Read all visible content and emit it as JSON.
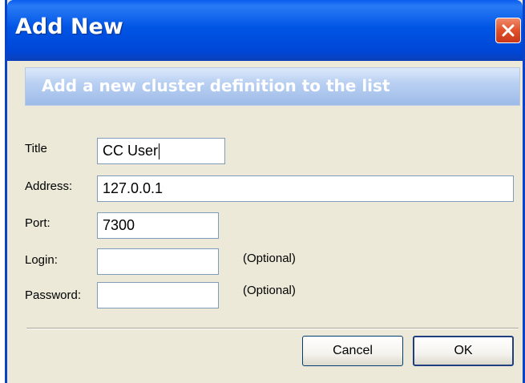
{
  "window": {
    "title": "Add New"
  },
  "banner": {
    "text": "Add a new cluster definition to the list"
  },
  "form": {
    "title_label": "Title",
    "title_value": "CC User",
    "address_label": "Address:",
    "address_value": "127.0.0.1",
    "port_label": "Port:",
    "port_value": "7300",
    "login_label": "Login:",
    "login_value": "",
    "login_hint": "(Optional)",
    "password_label": "Password:",
    "password_value": "",
    "password_hint": "(Optional)"
  },
  "buttons": {
    "cancel_label": "Cancel",
    "ok_label": "OK"
  },
  "icons": {
    "close": "close-icon"
  },
  "colors": {
    "titlebar": "#0055e5",
    "close_button": "#e0502a",
    "banner_text": "#ffffff",
    "dialog_background": "#ece9d8"
  }
}
